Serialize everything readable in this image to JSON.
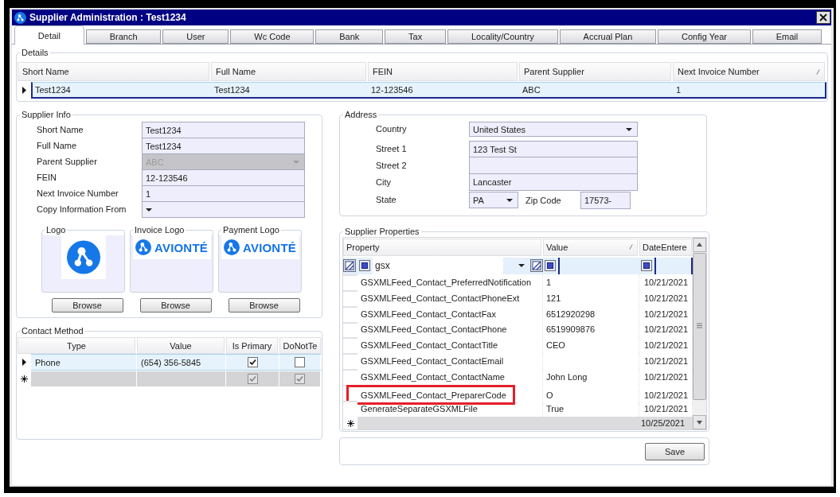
{
  "window": {
    "title": "Supplier Administration : Test1234"
  },
  "tabs": [
    {
      "label": "Detail",
      "selected": true
    },
    {
      "label": "Branch",
      "selected": false
    },
    {
      "label": "User",
      "selected": false
    },
    {
      "label": "Wc Code",
      "selected": false
    },
    {
      "label": "Bank",
      "selected": false
    },
    {
      "label": "Tax",
      "selected": false
    },
    {
      "label": "Locality/Country",
      "selected": false
    },
    {
      "label": "Accrual Plan",
      "selected": false
    },
    {
      "label": "Config Year",
      "selected": false
    },
    {
      "label": "Email",
      "selected": false
    }
  ],
  "details": {
    "title": "Details",
    "columns": [
      {
        "label": "Short Name",
        "sorted": false
      },
      {
        "label": "Full Name",
        "sorted": false
      },
      {
        "label": "FEIN",
        "sorted": false
      },
      {
        "label": "Parent Supplier",
        "sorted": false
      },
      {
        "label": "Next Invoice Number",
        "sorted": true
      }
    ],
    "rows": [
      {
        "selected": true,
        "cells": [
          "Test1234",
          "Test1234",
          "12-123546",
          "ABC",
          "1"
        ]
      }
    ]
  },
  "supplier_info": {
    "title": "Supplier Info",
    "fields": [
      {
        "label": "Short Name",
        "kind": "text",
        "value": "Test1234",
        "disabled": false
      },
      {
        "label": "Full Name",
        "kind": "text",
        "value": "Test1234",
        "disabled": false
      },
      {
        "label": "Parent Supplier",
        "kind": "combo",
        "value": "ABC",
        "disabled": true
      },
      {
        "label": "FEIN",
        "kind": "text",
        "value": "12-123546",
        "disabled": false
      },
      {
        "label": "Next Invoice Number",
        "kind": "text",
        "value": "1",
        "disabled": false
      },
      {
        "label": "Copy Information From",
        "kind": "combo",
        "disabled": false
      }
    ],
    "logos": [
      {
        "title": "Logo",
        "kind": "mark",
        "button": "Browse"
      },
      {
        "title": "Invoice Logo",
        "kind": "wordmark",
        "wordmark": "AVIONTÉ",
        "button": "Browse"
      },
      {
        "title": "Payment Logo",
        "kind": "wordmark",
        "wordmark": "AVIONTÉ",
        "button": "Browse"
      }
    ]
  },
  "contact_method": {
    "title": "Contact Method",
    "columns": [
      "Type",
      "Value",
      "Is Primary",
      "DoNotTe"
    ],
    "rows": [
      {
        "kind": "data",
        "selected": true,
        "type": "Phone",
        "value": "(654) 356-5845",
        "is_primary": true,
        "column_4": false
      },
      {
        "kind": "new",
        "selected": false,
        "is_primary": true,
        "column_4": true
      }
    ]
  },
  "address": {
    "title": "Address",
    "country": {
      "label": "Country",
      "value": "United States"
    },
    "street_1": {
      "label": "Street 1",
      "value": "123 Test St"
    },
    "street_2": {
      "label": "Street 2"
    },
    "city": {
      "label": "City",
      "value": "Lancaster"
    },
    "state": {
      "label": "State",
      "value": "PA"
    },
    "zip_code": {
      "label": "Zip Code",
      "value": "17573-"
    }
  },
  "supplier_properties": {
    "title": "Supplier Properties",
    "columns": [
      {
        "label": "Property",
        "sorted": false
      },
      {
        "label": "Value",
        "sorted": true
      },
      {
        "label": "DateEntere",
        "sorted": false
      }
    ],
    "filter": {
      "value": "gsx"
    },
    "rows": [
      {
        "property": "GSXMLFeed_Contact_PreferredNotification",
        "value": "1",
        "date": "10/21/2021",
        "highlighted": false
      },
      {
        "property": "GSXMLFeed_Contact_ContactPhoneExt",
        "value": "121",
        "date": "10/21/2021",
        "highlighted": false
      },
      {
        "property": "GSXMLFeed_Contact_ContactFax",
        "value": "6512920298",
        "date": "10/21/2021",
        "highlighted": false
      },
      {
        "property": "GSXMLFeed_Contact_ContactPhone",
        "value": "6519909876",
        "date": "10/21/2021",
        "highlighted": false
      },
      {
        "property": "GSXMLFeed_Contact_ContactTitle",
        "value": "CEO",
        "date": "10/21/2021",
        "highlighted": false
      },
      {
        "property": "GSXMLFeed_Contact_ContactEmail",
        "date": "10/21/2021",
        "highlighted": false
      },
      {
        "property": "GSXMLFeed_Contact_ContactName",
        "value": "John Long",
        "date": "10/21/2021",
        "highlighted": false
      },
      {
        "property": "GSXMLFeed_Contact_PreparerCode",
        "value": "O",
        "date": "10/21/2021",
        "highlighted": true
      },
      {
        "property": "GenerateSeparateGSXMLFile",
        "value": "True",
        "date": "10/21/2021",
        "highlighted": false
      }
    ],
    "new_row": {
      "date": "10/25/2021"
    }
  },
  "save_button": {
    "label": "Save"
  }
}
